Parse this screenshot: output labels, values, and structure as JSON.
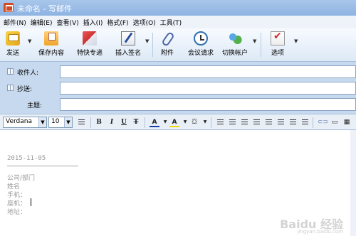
{
  "window": {
    "title": "未命名 - 写邮件"
  },
  "menu": [
    "邮件(N)",
    "编辑(E)",
    "查看(V)",
    "插入(I)",
    "格式(F)",
    "选项(O)",
    "工具(T)"
  ],
  "toolbar": {
    "send": "发送",
    "save": "保存内容",
    "special": "特快专递",
    "signature": "插入签名",
    "attach": "附件",
    "meeting": "会议请求",
    "switch_account": "切换帐户",
    "options": "选项"
  },
  "fields": {
    "to_label": "收件人:",
    "to_value": "",
    "cc_label": "抄送:",
    "cc_value": "",
    "subject_label": "主题:",
    "subject_value": ""
  },
  "format": {
    "font": "Verdana",
    "size": "10",
    "bold": "B",
    "italic": "I",
    "underline": "U",
    "strike": "T"
  },
  "body": {
    "date": "2015-11-05",
    "lines": [
      "公司/部门",
      "姓名",
      "手机：",
      "座机：",
      "地址："
    ]
  },
  "watermark": {
    "brand": "Baidu 经验",
    "sub": "jingyan.baidu.com"
  }
}
